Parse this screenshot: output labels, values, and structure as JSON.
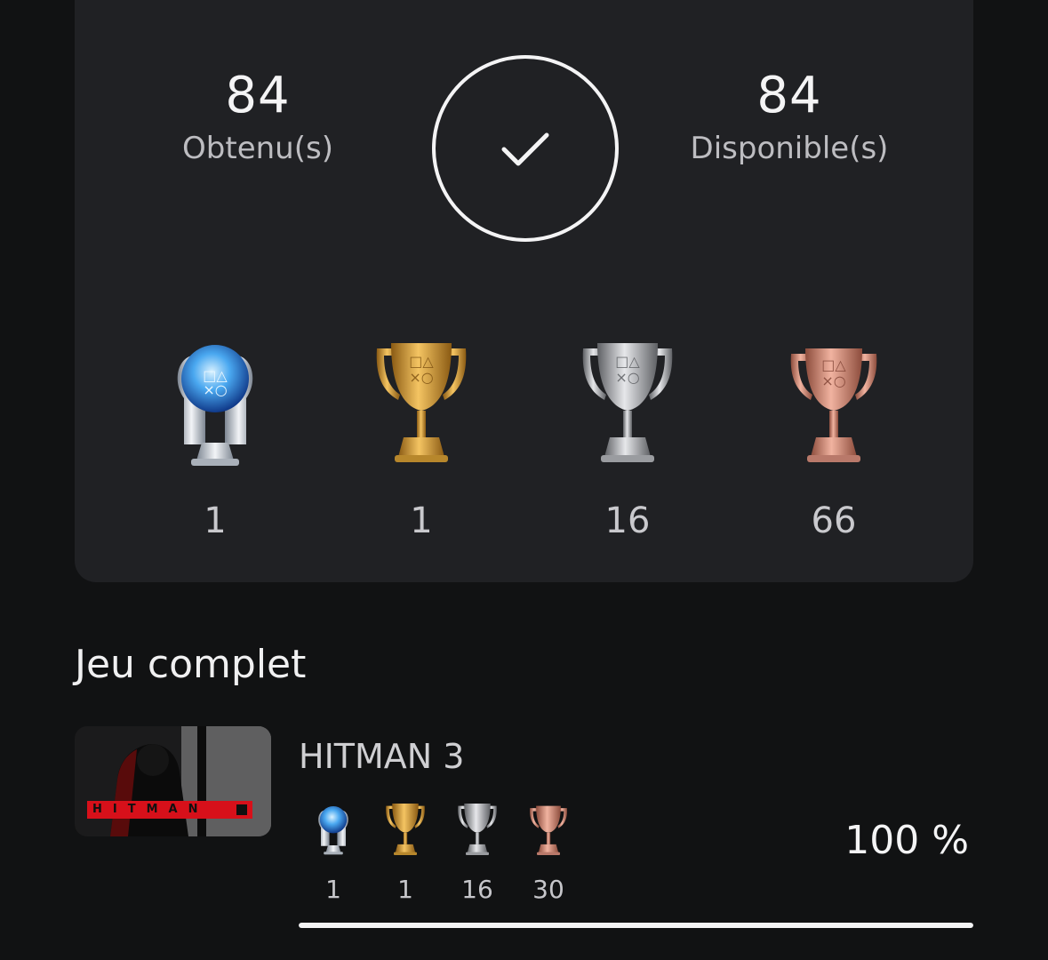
{
  "summary": {
    "earned_value": "84",
    "earned_label": "Obtenu(s)",
    "available_value": "84",
    "available_label": "Disponible(s)",
    "completed_icon": "checkmark-icon"
  },
  "trophies": [
    {
      "type": "platinum",
      "icon": "platinum-trophy-icon",
      "count": "1"
    },
    {
      "type": "gold",
      "icon": "gold-trophy-icon",
      "count": "1"
    },
    {
      "type": "silver",
      "icon": "silver-trophy-icon",
      "count": "16"
    },
    {
      "type": "bronze",
      "icon": "bronze-trophy-icon",
      "count": "66"
    }
  ],
  "section": {
    "title": "Jeu complet"
  },
  "game": {
    "title": "HITMAN 3",
    "thumb_text": "HITMAN",
    "trophies": [
      {
        "type": "platinum",
        "count": "1"
      },
      {
        "type": "gold",
        "count": "1"
      },
      {
        "type": "silver",
        "count": "16"
      },
      {
        "type": "bronze",
        "count": "30"
      }
    ],
    "progress_label": "100 %",
    "progress_fraction": 1.0
  },
  "colors": {
    "background": "#111213",
    "card": "#202124",
    "platinum": "#4aa8f0",
    "gold": "#d9a23a",
    "silver": "#b8b8bb",
    "bronze": "#d08b78",
    "brand_red": "#d7101a"
  }
}
